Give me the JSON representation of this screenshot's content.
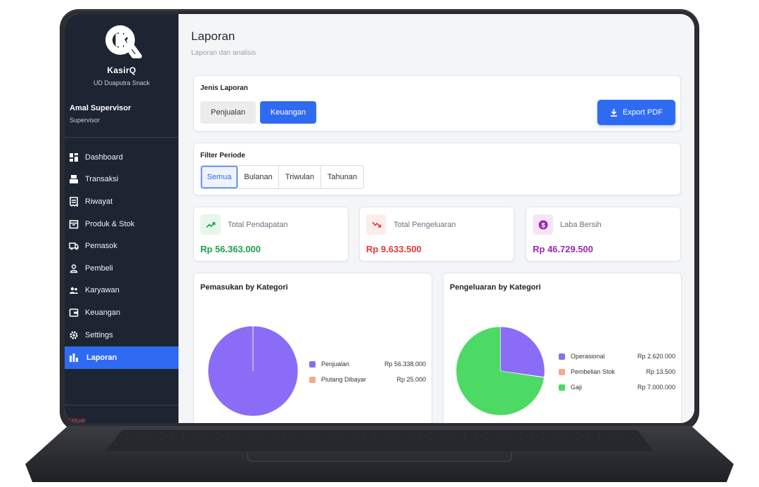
{
  "app": {
    "brand_name": "KasirQ",
    "brand_subtitle": "UD Duaputra Snack",
    "user_name": "Amal Supervisor",
    "user_role": "Supervisor",
    "logout_label": "Keluar"
  },
  "sidebar": {
    "items": [
      {
        "label": "Dashboard",
        "icon": "dashboard-icon"
      },
      {
        "label": "Transaksi",
        "icon": "cashier-icon"
      },
      {
        "label": "Riwayat",
        "icon": "receipt-icon"
      },
      {
        "label": "Produk & Stok",
        "icon": "box-icon"
      },
      {
        "label": "Pemasok",
        "icon": "truck-icon"
      },
      {
        "label": "Pembeli",
        "icon": "person-icon"
      },
      {
        "label": "Karyawan",
        "icon": "group-icon"
      },
      {
        "label": "Keuangan",
        "icon": "wallet-icon"
      },
      {
        "label": "Settings",
        "icon": "gear-icon"
      },
      {
        "label": "Laporan",
        "icon": "bar-chart-icon",
        "active": true
      }
    ]
  },
  "header": {
    "title": "Laporan",
    "subtitle": "Laporan dan analisis"
  },
  "report_type": {
    "label": "Jenis Laporan",
    "options": [
      "Penjualan",
      "Keuangan"
    ],
    "selected": "Keuangan",
    "export_label": "Export PDF"
  },
  "period_filter": {
    "label": "Filter Periode",
    "options": [
      "Semua",
      "Bulanan",
      "Triwulan",
      "Tahunan"
    ],
    "selected": "Semua"
  },
  "stats": [
    {
      "label": "Total Pendapatan",
      "value": "Rp 56.363.000",
      "color": "#1e9e4a",
      "icon": "trending-up-icon",
      "icon_bg": "#e6f6ea"
    },
    {
      "label": "Total Pengeluaran",
      "value": "Rp 9.633.500",
      "color": "#e53935",
      "icon": "trending-down-icon",
      "icon_bg": "#fdecec"
    },
    {
      "label": "Laba Bersih",
      "value": "Rp 46.729.500",
      "color": "#9b27b0",
      "icon": "dollar-circle-icon",
      "icon_bg": "#f4e6f7"
    }
  ],
  "chart_data": [
    {
      "type": "pie",
      "title": "Pemasukan by Kategori",
      "categories": [
        "Penjualan",
        "Piutang Dibayar"
      ],
      "values": [
        56338000,
        25000
      ],
      "value_labels": [
        "Rp 56.338.000",
        "Rp 25.000"
      ],
      "colors": [
        "#8b6cf6",
        "#f5a98b"
      ],
      "legend": "right"
    },
    {
      "type": "pie",
      "title": "Pengeluaran by Kategori",
      "categories": [
        "Operasional",
        "Pembelian Stok",
        "Gaji"
      ],
      "values": [
        2620000,
        13500,
        7000000
      ],
      "value_labels": [
        "Rp 2.620.000",
        "Rp 13.500",
        "Rp 7.000.000"
      ],
      "colors": [
        "#8b6cf6",
        "#f5a98b",
        "#4cd964"
      ],
      "legend": "right"
    }
  ]
}
